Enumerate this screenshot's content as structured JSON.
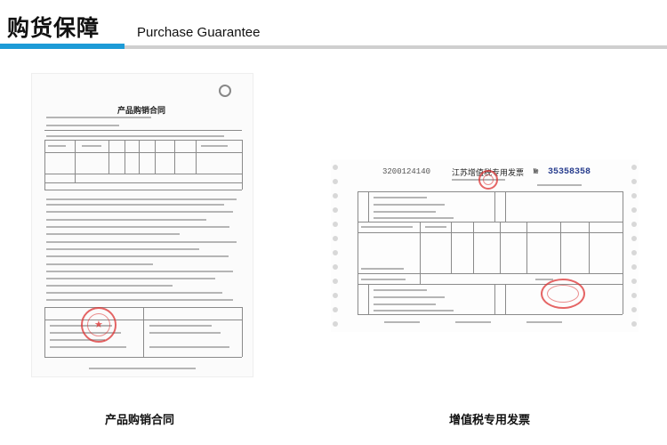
{
  "header": {
    "title_cn": "购货保障",
    "title_en": "Purchase Guarantee",
    "accent_color": "#1d9bd7",
    "divider_color": "#cfcfcf"
  },
  "documents": [
    {
      "caption": "产品购销合同",
      "doc_title": "产品购销合同"
    },
    {
      "caption": "增值税专用发票",
      "invoice_code": "3200124140",
      "invoice_title": "江苏增值税专用发票",
      "invoice_number_prefix": "№",
      "invoice_number": "35358358"
    }
  ],
  "colors": {
    "seal_red": "#dc3232"
  }
}
